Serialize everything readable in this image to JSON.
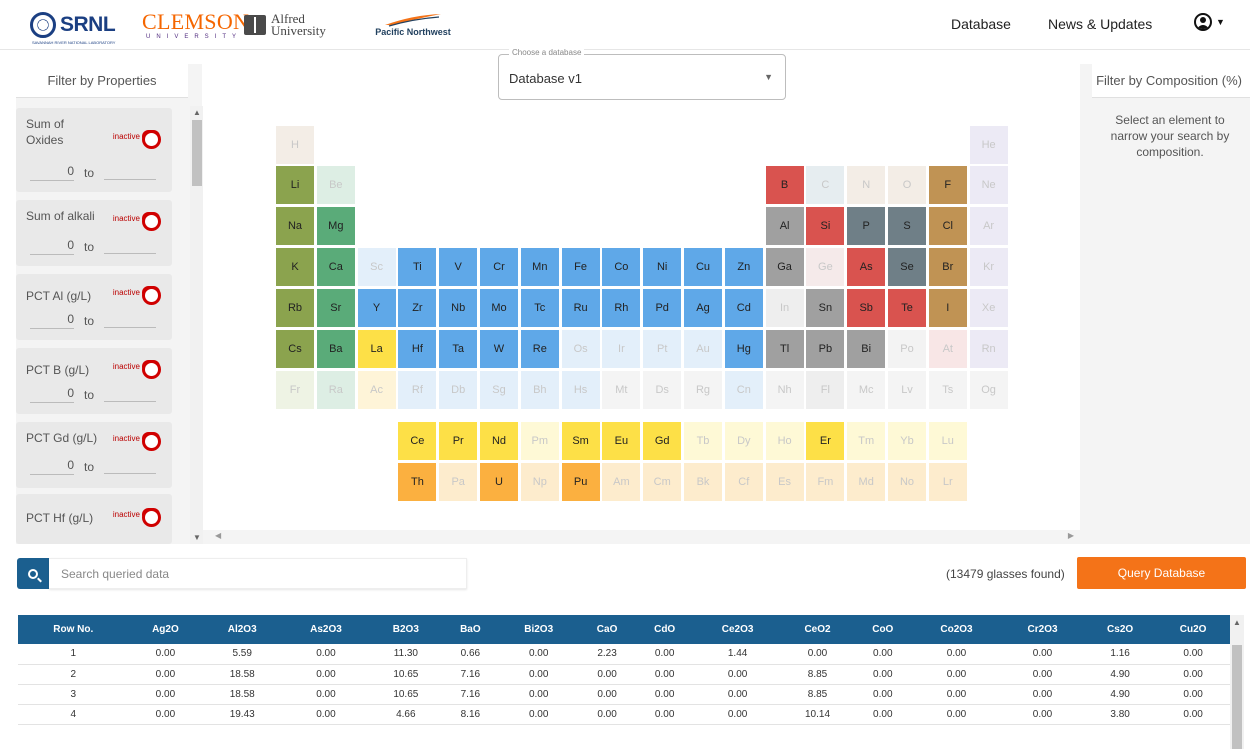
{
  "header": {
    "logos": {
      "srnl": "SRNL",
      "srnl_sub": "SAVANNAH RIVER NATIONAL LABORATORY",
      "clemson": "CLEMSON",
      "clemson_sub": "UNIVERSITY",
      "alfred": "Alfred\nUniversity",
      "pnnl": "Pacific Northwest"
    },
    "nav": {
      "database": "Database",
      "news": "News & Updates"
    },
    "icons": {
      "user": "user-circle-icon",
      "caret": "caret-down-icon"
    }
  },
  "left_panel": {
    "title": "Filter by Properties",
    "filters": [
      {
        "label": "Sum of Oxides",
        "status": "inactive",
        "min": "0",
        "to": "to",
        "max": ""
      },
      {
        "label": "Sum of alkali",
        "status": "inactive",
        "min": "0",
        "to": "to",
        "max": ""
      },
      {
        "label": "PCT Al (g/L)",
        "status": "inactive",
        "min": "0",
        "to": "to",
        "max": ""
      },
      {
        "label": "PCT B (g/L)",
        "status": "inactive",
        "min": "0",
        "to": "to",
        "max": ""
      },
      {
        "label": "PCT Gd (g/L)",
        "status": "inactive",
        "min": "0",
        "to": "to",
        "max": ""
      },
      {
        "label": "PCT Hf (g/L)",
        "status": "inactive"
      }
    ]
  },
  "db_select": {
    "label": "Choose a database",
    "value": "Database v1"
  },
  "periodic_table": {
    "elements": [
      {
        "s": "H",
        "r": 0,
        "c": 0,
        "col": "#f3ede6",
        "on": false
      },
      {
        "s": "He",
        "r": 0,
        "c": 17,
        "col": "#eceaf5",
        "on": false
      },
      {
        "s": "Li",
        "r": 1,
        "c": 0,
        "col": "#8ba34e",
        "on": true
      },
      {
        "s": "Be",
        "r": 1,
        "c": 1,
        "col": "#ddeee4",
        "on": false
      },
      {
        "s": "B",
        "r": 1,
        "c": 12,
        "col": "#d9534f",
        "on": true
      },
      {
        "s": "C",
        "r": 1,
        "c": 13,
        "col": "#e6edf0",
        "on": false
      },
      {
        "s": "N",
        "r": 1,
        "c": 14,
        "col": "#f3ede6",
        "on": false
      },
      {
        "s": "O",
        "r": 1,
        "c": 15,
        "col": "#f3ede6",
        "on": false
      },
      {
        "s": "F",
        "r": 1,
        "c": 16,
        "col": "#c09354",
        "on": true
      },
      {
        "s": "Ne",
        "r": 1,
        "c": 17,
        "col": "#eceaf5",
        "on": false
      },
      {
        "s": "Na",
        "r": 2,
        "c": 0,
        "col": "#8ba34e",
        "on": true
      },
      {
        "s": "Mg",
        "r": 2,
        "c": 1,
        "col": "#5aab79",
        "on": true
      },
      {
        "s": "Al",
        "r": 2,
        "c": 12,
        "col": "#a0a0a0",
        "on": true
      },
      {
        "s": "Si",
        "r": 2,
        "c": 13,
        "col": "#d9534f",
        "on": true
      },
      {
        "s": "P",
        "r": 2,
        "c": 14,
        "col": "#6f7f87",
        "on": true
      },
      {
        "s": "S",
        "r": 2,
        "c": 15,
        "col": "#6f7f87",
        "on": true
      },
      {
        "s": "Cl",
        "r": 2,
        "c": 16,
        "col": "#c09354",
        "on": true
      },
      {
        "s": "Ar",
        "r": 2,
        "c": 17,
        "col": "#eceaf5",
        "on": false
      },
      {
        "s": "K",
        "r": 3,
        "c": 0,
        "col": "#8ba34e",
        "on": true
      },
      {
        "s": "Ca",
        "r": 3,
        "c": 1,
        "col": "#5aab79",
        "on": true
      },
      {
        "s": "Sc",
        "r": 3,
        "c": 2,
        "col": "#e3effa",
        "on": false
      },
      {
        "s": "Ti",
        "r": 3,
        "c": 3,
        "col": "#5fa8e8",
        "on": true
      },
      {
        "s": "V",
        "r": 3,
        "c": 4,
        "col": "#5fa8e8",
        "on": true
      },
      {
        "s": "Cr",
        "r": 3,
        "c": 5,
        "col": "#5fa8e8",
        "on": true
      },
      {
        "s": "Mn",
        "r": 3,
        "c": 6,
        "col": "#5fa8e8",
        "on": true
      },
      {
        "s": "Fe",
        "r": 3,
        "c": 7,
        "col": "#5fa8e8",
        "on": true
      },
      {
        "s": "Co",
        "r": 3,
        "c": 8,
        "col": "#5fa8e8",
        "on": true
      },
      {
        "s": "Ni",
        "r": 3,
        "c": 9,
        "col": "#5fa8e8",
        "on": true
      },
      {
        "s": "Cu",
        "r": 3,
        "c": 10,
        "col": "#5fa8e8",
        "on": true
      },
      {
        "s": "Zn",
        "r": 3,
        "c": 11,
        "col": "#5fa8e8",
        "on": true
      },
      {
        "s": "Ga",
        "r": 3,
        "c": 12,
        "col": "#a0a0a0",
        "on": true
      },
      {
        "s": "Ge",
        "r": 3,
        "c": 13,
        "col": "#f5eaea",
        "on": false
      },
      {
        "s": "As",
        "r": 3,
        "c": 14,
        "col": "#d9534f",
        "on": true
      },
      {
        "s": "Se",
        "r": 3,
        "c": 15,
        "col": "#6f7f87",
        "on": true
      },
      {
        "s": "Br",
        "r": 3,
        "c": 16,
        "col": "#c09354",
        "on": true
      },
      {
        "s": "Kr",
        "r": 3,
        "c": 17,
        "col": "#eceaf5",
        "on": false
      },
      {
        "s": "Rb",
        "r": 4,
        "c": 0,
        "col": "#8ba34e",
        "on": true
      },
      {
        "s": "Sr",
        "r": 4,
        "c": 1,
        "col": "#5aab79",
        "on": true
      },
      {
        "s": "Y",
        "r": 4,
        "c": 2,
        "col": "#5fa8e8",
        "on": true
      },
      {
        "s": "Zr",
        "r": 4,
        "c": 3,
        "col": "#5fa8e8",
        "on": true
      },
      {
        "s": "Nb",
        "r": 4,
        "c": 4,
        "col": "#5fa8e8",
        "on": true
      },
      {
        "s": "Mo",
        "r": 4,
        "c": 5,
        "col": "#5fa8e8",
        "on": true
      },
      {
        "s": "Tc",
        "r": 4,
        "c": 6,
        "col": "#5fa8e8",
        "on": true
      },
      {
        "s": "Ru",
        "r": 4,
        "c": 7,
        "col": "#5fa8e8",
        "on": true
      },
      {
        "s": "Rh",
        "r": 4,
        "c": 8,
        "col": "#5fa8e8",
        "on": true
      },
      {
        "s": "Pd",
        "r": 4,
        "c": 9,
        "col": "#5fa8e8",
        "on": true
      },
      {
        "s": "Ag",
        "r": 4,
        "c": 10,
        "col": "#5fa8e8",
        "on": true
      },
      {
        "s": "Cd",
        "r": 4,
        "c": 11,
        "col": "#5fa8e8",
        "on": true
      },
      {
        "s": "In",
        "r": 4,
        "c": 12,
        "col": "#eeeeee",
        "on": false
      },
      {
        "s": "Sn",
        "r": 4,
        "c": 13,
        "col": "#a0a0a0",
        "on": true
      },
      {
        "s": "Sb",
        "r": 4,
        "c": 14,
        "col": "#d9534f",
        "on": true
      },
      {
        "s": "Te",
        "r": 4,
        "c": 15,
        "col": "#d9534f",
        "on": true
      },
      {
        "s": "I",
        "r": 4,
        "c": 16,
        "col": "#c09354",
        "on": true
      },
      {
        "s": "Xe",
        "r": 4,
        "c": 17,
        "col": "#eceaf5",
        "on": false
      },
      {
        "s": "Cs",
        "r": 5,
        "c": 0,
        "col": "#8ba34e",
        "on": true
      },
      {
        "s": "Ba",
        "r": 5,
        "c": 1,
        "col": "#5aab79",
        "on": true
      },
      {
        "s": "La",
        "r": 5,
        "c": 2,
        "col": "#fde047",
        "on": true
      },
      {
        "s": "Hf",
        "r": 5,
        "c": 3,
        "col": "#5fa8e8",
        "on": true
      },
      {
        "s": "Ta",
        "r": 5,
        "c": 4,
        "col": "#5fa8e8",
        "on": true
      },
      {
        "s": "W",
        "r": 5,
        "c": 5,
        "col": "#5fa8e8",
        "on": true
      },
      {
        "s": "Re",
        "r": 5,
        "c": 6,
        "col": "#5fa8e8",
        "on": true
      },
      {
        "s": "Os",
        "r": 5,
        "c": 7,
        "col": "#e3effa",
        "on": false
      },
      {
        "s": "Ir",
        "r": 5,
        "c": 8,
        "col": "#e3effa",
        "on": false
      },
      {
        "s": "Pt",
        "r": 5,
        "c": 9,
        "col": "#e3effa",
        "on": false
      },
      {
        "s": "Au",
        "r": 5,
        "c": 10,
        "col": "#e3effa",
        "on": false
      },
      {
        "s": "Hg",
        "r": 5,
        "c": 11,
        "col": "#5fa8e8",
        "on": true
      },
      {
        "s": "Tl",
        "r": 5,
        "c": 12,
        "col": "#a0a0a0",
        "on": true
      },
      {
        "s": "Pb",
        "r": 5,
        "c": 13,
        "col": "#a0a0a0",
        "on": true
      },
      {
        "s": "Bi",
        "r": 5,
        "c": 14,
        "col": "#a0a0a0",
        "on": true
      },
      {
        "s": "Po",
        "r": 5,
        "c": 15,
        "col": "#f3f3f3",
        "on": false
      },
      {
        "s": "At",
        "r": 5,
        "c": 16,
        "col": "#f8e6e6",
        "on": false
      },
      {
        "s": "Rn",
        "r": 5,
        "c": 17,
        "col": "#eceaf5",
        "on": false
      },
      {
        "s": "Fr",
        "r": 6,
        "c": 0,
        "col": "#eef3e4",
        "on": false
      },
      {
        "s": "Ra",
        "r": 6,
        "c": 1,
        "col": "#ddeee4",
        "on": false
      },
      {
        "s": "Ac",
        "r": 6,
        "c": 2,
        "col": "#fef4d8",
        "on": false
      },
      {
        "s": "Rf",
        "r": 6,
        "c": 3,
        "col": "#e3effa",
        "on": false
      },
      {
        "s": "Db",
        "r": 6,
        "c": 4,
        "col": "#e3effa",
        "on": false
      },
      {
        "s": "Sg",
        "r": 6,
        "c": 5,
        "col": "#e3effa",
        "on": false
      },
      {
        "s": "Bh",
        "r": 6,
        "c": 6,
        "col": "#e3effa",
        "on": false
      },
      {
        "s": "Hs",
        "r": 6,
        "c": 7,
        "col": "#e3effa",
        "on": false
      },
      {
        "s": "Mt",
        "r": 6,
        "c": 8,
        "col": "#f4f4f4",
        "on": false
      },
      {
        "s": "Ds",
        "r": 6,
        "c": 9,
        "col": "#f4f4f4",
        "on": false
      },
      {
        "s": "Rg",
        "r": 6,
        "c": 10,
        "col": "#f4f4f4",
        "on": false
      },
      {
        "s": "Cn",
        "r": 6,
        "c": 11,
        "col": "#e3effa",
        "on": false
      },
      {
        "s": "Nh",
        "r": 6,
        "c": 12,
        "col": "#f4f4f4",
        "on": false
      },
      {
        "s": "Fl",
        "r": 6,
        "c": 13,
        "col": "#eeeeee",
        "on": false
      },
      {
        "s": "Mc",
        "r": 6,
        "c": 14,
        "col": "#f4f4f4",
        "on": false
      },
      {
        "s": "Lv",
        "r": 6,
        "c": 15,
        "col": "#f4f4f4",
        "on": false
      },
      {
        "s": "Ts",
        "r": 6,
        "c": 16,
        "col": "#f4f4f4",
        "on": false
      },
      {
        "s": "Og",
        "r": 6,
        "c": 17,
        "col": "#f4f4f4",
        "on": false
      },
      {
        "s": "Ce",
        "r": 7,
        "c": 3,
        "col": "#fde047",
        "on": true
      },
      {
        "s": "Pr",
        "r": 7,
        "c": 4,
        "col": "#fde047",
        "on": true
      },
      {
        "s": "Nd",
        "r": 7,
        "c": 5,
        "col": "#fde047",
        "on": true
      },
      {
        "s": "Pm",
        "r": 7,
        "c": 6,
        "col": "#fef9d6",
        "on": false
      },
      {
        "s": "Sm",
        "r": 7,
        "c": 7,
        "col": "#fde047",
        "on": true
      },
      {
        "s": "Eu",
        "r": 7,
        "c": 8,
        "col": "#fde047",
        "on": true
      },
      {
        "s": "Gd",
        "r": 7,
        "c": 9,
        "col": "#fde047",
        "on": true
      },
      {
        "s": "Tb",
        "r": 7,
        "c": 10,
        "col": "#fef9d6",
        "on": false
      },
      {
        "s": "Dy",
        "r": 7,
        "c": 11,
        "col": "#fef9d6",
        "on": false
      },
      {
        "s": "Ho",
        "r": 7,
        "c": 12,
        "col": "#fef9d6",
        "on": false
      },
      {
        "s": "Er",
        "r": 7,
        "c": 13,
        "col": "#fde047",
        "on": true
      },
      {
        "s": "Tm",
        "r": 7,
        "c": 14,
        "col": "#fef9d6",
        "on": false
      },
      {
        "s": "Yb",
        "r": 7,
        "c": 15,
        "col": "#fef9d6",
        "on": false
      },
      {
        "s": "Lu",
        "r": 7,
        "c": 16,
        "col": "#fef9d6",
        "on": false
      },
      {
        "s": "Th",
        "r": 8,
        "c": 3,
        "col": "#fbb040",
        "on": true
      },
      {
        "s": "Pa",
        "r": 8,
        "c": 4,
        "col": "#fdeccd",
        "on": false
      },
      {
        "s": "U",
        "r": 8,
        "c": 5,
        "col": "#fbb040",
        "on": true
      },
      {
        "s": "Np",
        "r": 8,
        "c": 6,
        "col": "#fdeccd",
        "on": false
      },
      {
        "s": "Pu",
        "r": 8,
        "c": 7,
        "col": "#fbb040",
        "on": true
      },
      {
        "s": "Am",
        "r": 8,
        "c": 8,
        "col": "#fdeccd",
        "on": false
      },
      {
        "s": "Cm",
        "r": 8,
        "c": 9,
        "col": "#fdeccd",
        "on": false
      },
      {
        "s": "Bk",
        "r": 8,
        "c": 10,
        "col": "#fdeccd",
        "on": false
      },
      {
        "s": "Cf",
        "r": 8,
        "c": 11,
        "col": "#fdeccd",
        "on": false
      },
      {
        "s": "Es",
        "r": 8,
        "c": 12,
        "col": "#fdeccd",
        "on": false
      },
      {
        "s": "Fm",
        "r": 8,
        "c": 13,
        "col": "#fdeccd",
        "on": false
      },
      {
        "s": "Md",
        "r": 8,
        "c": 14,
        "col": "#fdeccd",
        "on": false
      },
      {
        "s": "No",
        "r": 8,
        "c": 15,
        "col": "#fdeccd",
        "on": false
      },
      {
        "s": "Lr",
        "r": 8,
        "c": 16,
        "col": "#fdeccd",
        "on": false
      }
    ]
  },
  "right_panel": {
    "title": "Filter by Composition (%)",
    "hint": "Select an element to narrow your search by composition."
  },
  "search": {
    "placeholder": "Search queried data",
    "icon": "search-icon"
  },
  "results": {
    "found": "(13479 glasses found)",
    "query_button": "Query Database"
  },
  "table": {
    "columns": [
      "Row No.",
      "Ag2O",
      "Al2O3",
      "As2O3",
      "B2O3",
      "BaO",
      "Bi2O3",
      "CaO",
      "CdO",
      "Ce2O3",
      "CeO2",
      "CoO",
      "Co2O3",
      "Cr2O3",
      "Cs2O",
      "Cu2O"
    ],
    "rows": [
      [
        "1",
        "0.00",
        "5.59",
        "0.00",
        "11.30",
        "0.66",
        "0.00",
        "2.23",
        "0.00",
        "1.44",
        "0.00",
        "0.00",
        "0.00",
        "0.00",
        "1.16",
        "0.00"
      ],
      [
        "2",
        "0.00",
        "18.58",
        "0.00",
        "10.65",
        "7.16",
        "0.00",
        "0.00",
        "0.00",
        "0.00",
        "8.85",
        "0.00",
        "0.00",
        "0.00",
        "4.90",
        "0.00"
      ],
      [
        "3",
        "0.00",
        "18.58",
        "0.00",
        "10.65",
        "7.16",
        "0.00",
        "0.00",
        "0.00",
        "0.00",
        "8.85",
        "0.00",
        "0.00",
        "0.00",
        "4.90",
        "0.00"
      ],
      [
        "4",
        "0.00",
        "19.43",
        "0.00",
        "4.66",
        "8.16",
        "0.00",
        "0.00",
        "0.00",
        "0.00",
        "10.14",
        "0.00",
        "0.00",
        "0.00",
        "3.80",
        "0.00"
      ]
    ]
  },
  "colors": {
    "accent": "#1b5f8f",
    "query": "#f47318",
    "toggle": "#d00000"
  }
}
